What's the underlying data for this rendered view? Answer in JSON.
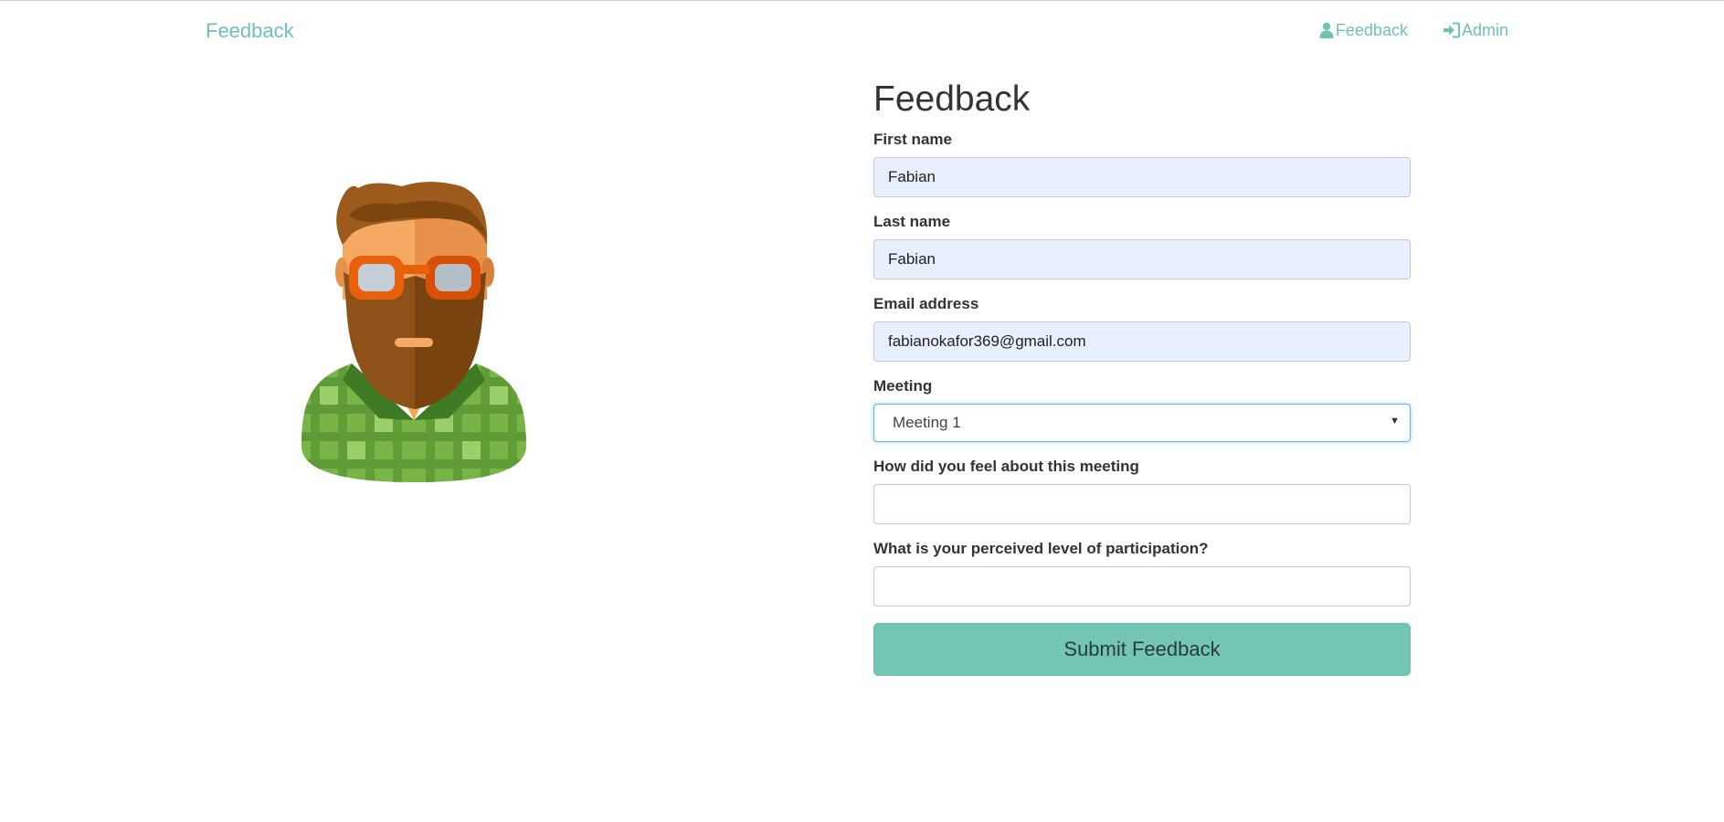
{
  "navbar": {
    "brand": "Feedback",
    "links": [
      {
        "label": "Feedback",
        "icon": "user-icon"
      },
      {
        "label": "Admin",
        "icon": "sign-in-icon"
      }
    ],
    "link_color": "#6fc2b0"
  },
  "avatar": {
    "icon": "bearded-man-avatar-icon"
  },
  "form": {
    "title": "Feedback",
    "first_name": {
      "label": "First name",
      "value": "Fabian"
    },
    "last_name": {
      "label": "Last name",
      "value": "Fabian"
    },
    "email": {
      "label": "Email address",
      "value": "fabianokafor369@gmail.com"
    },
    "meeting": {
      "label": "Meeting",
      "selected": "Meeting 1"
    },
    "feeling": {
      "label": "How did you feel about this meeting",
      "value": ""
    },
    "participation": {
      "label": "What is your perceived level of participation?",
      "value": ""
    },
    "submit_label": "Submit Feedback",
    "submit_color": "#73c6b3"
  }
}
